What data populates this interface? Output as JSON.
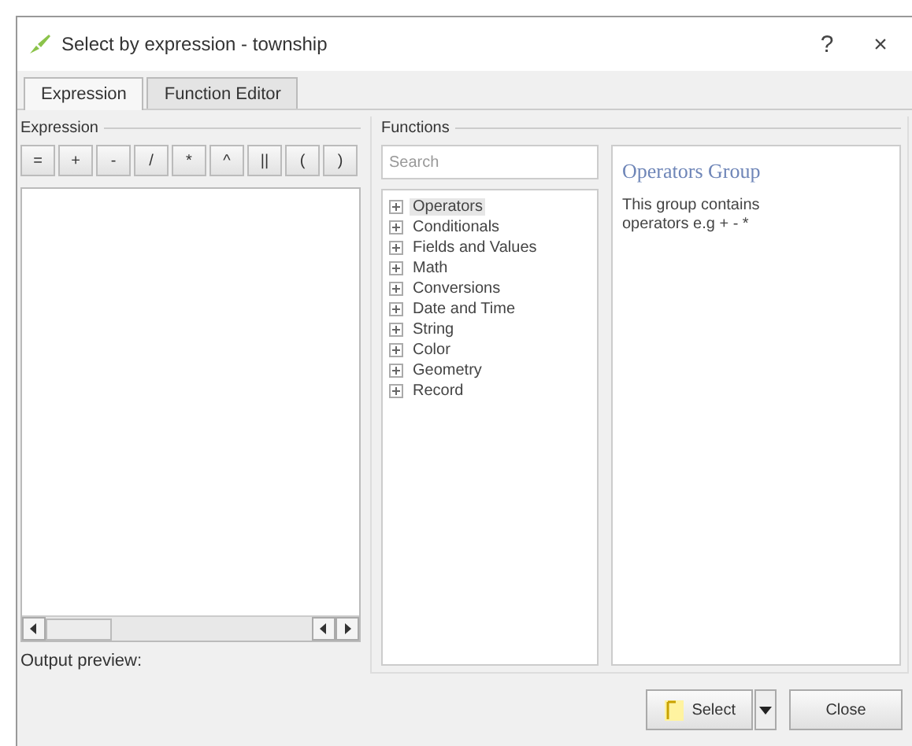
{
  "window": {
    "title": "Select by expression - township",
    "controls": [
      "?",
      "×"
    ]
  },
  "tabs": [
    {
      "label": "Expression",
      "selected": true
    },
    {
      "label": "Function Editor",
      "selected": false
    }
  ],
  "expression": {
    "label": "Expression",
    "operators": [
      "=",
      "+",
      "-",
      "/",
      "*",
      "^",
      "||",
      "(",
      ")"
    ],
    "output_preview": "Output preview:"
  },
  "functions": {
    "label": "Functions",
    "search": {
      "placeholder": "Search"
    },
    "groups": [
      {
        "label": "Operators",
        "selected": true
      },
      {
        "label": "Conditionals",
        "selected": false
      },
      {
        "label": "Fields and Values",
        "selected": false
      },
      {
        "label": "Math",
        "selected": false
      },
      {
        "label": "Conversions",
        "selected": false
      },
      {
        "label": "Date and Time",
        "selected": false
      },
      {
        "label": "String",
        "selected": false
      },
      {
        "label": "Color",
        "selected": false
      },
      {
        "label": "Geometry",
        "selected": false
      },
      {
        "label": "Record",
        "selected": false
      }
    ],
    "help": {
      "title": "Operators Group",
      "text": "This group contains operators e.g + - *"
    }
  },
  "buttons": [
    {
      "label": "Select",
      "kind": "split"
    },
    {
      "label": "Close",
      "kind": "plain"
    }
  ]
}
